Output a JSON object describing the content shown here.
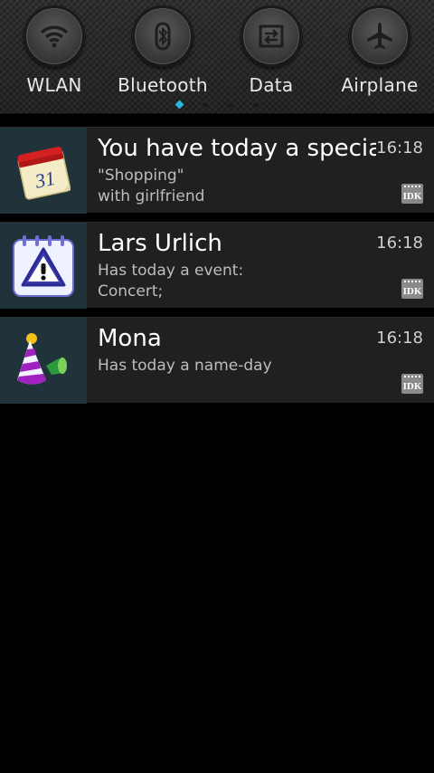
{
  "quick_settings": {
    "items": [
      {
        "label": "WLAN",
        "icon": "wifi-icon"
      },
      {
        "label": "Bluetooth",
        "icon": "bluetooth-icon"
      },
      {
        "label": "Data",
        "icon": "data-icon"
      },
      {
        "label": "Airplane",
        "icon": "airplane-icon"
      }
    ],
    "page_count": 4,
    "active_page": 1,
    "accent_color": "#2fb3e0"
  },
  "notifications": [
    {
      "title": "You have today a specia..",
      "time": "16:18",
      "line1": "\"Shopping\"",
      "line2": "with girlfriend",
      "icon": "calendar-31-icon",
      "badge": "IDK"
    },
    {
      "title": "Lars Urlich",
      "time": "16:18",
      "line1": "Has today a event:",
      "line2": "Concert;",
      "icon": "warning-calendar-icon",
      "badge": "IDK"
    },
    {
      "title": "Mona",
      "time": "16:18",
      "line1": "Has today a name-day",
      "line2": "",
      "icon": "party-hat-icon",
      "badge": "IDK"
    }
  ]
}
